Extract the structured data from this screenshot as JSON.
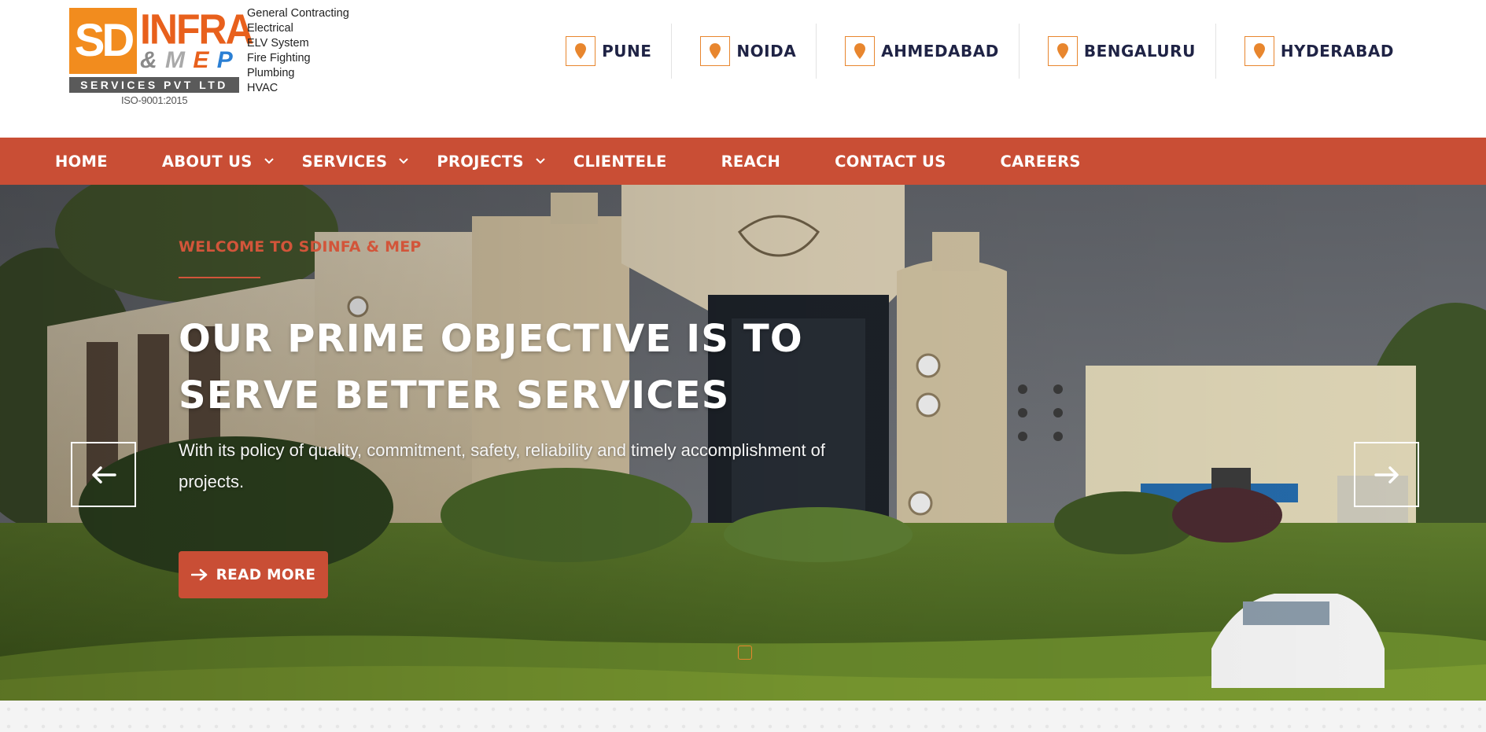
{
  "logo": {
    "mark": "SD",
    "wordmark": "INFRA",
    "mep": {
      "amp": "&",
      "m": "M",
      "e": "E",
      "p": "P"
    },
    "tagline": "SERVICES PVT LTD",
    "certification": "ISO-9001:2015",
    "services": [
      "General Contracting",
      "Electrical",
      "ELV System",
      "Fire Fighting",
      "Plumbing",
      "HVAC"
    ]
  },
  "locations": [
    {
      "label": "PUNE",
      "icon": "map-pin-icon"
    },
    {
      "label": "NOIDA",
      "icon": "map-pin-icon"
    },
    {
      "label": "AHMEDABAD",
      "icon": "map-pin-icon"
    },
    {
      "label": "BENGALURU",
      "icon": "map-pin-icon"
    },
    {
      "label": "HYDERABAD",
      "icon": "map-pin-icon"
    }
  ],
  "nav": {
    "items": [
      {
        "label": "HOME",
        "dropdown": false
      },
      {
        "label": "ABOUT US",
        "dropdown": true
      },
      {
        "label": "SERVICES",
        "dropdown": true
      },
      {
        "label": "PROJECTS",
        "dropdown": true
      },
      {
        "label": "CLIENTELE",
        "dropdown": false
      },
      {
        "label": "REACH",
        "dropdown": false
      },
      {
        "label": "CONTACT US",
        "dropdown": false
      },
      {
        "label": "CAREERS",
        "dropdown": false
      }
    ]
  },
  "hero": {
    "eyebrow": "WELCOME TO SDINFA & MEP",
    "title_line1": "OUR PRIME OBJECTIVE IS TO",
    "title_line2": "SERVE BETTER SERVICES",
    "description": "With its policy of quality, commitment, safety, reliability and timely accomplishment of projects.",
    "cta_label": "READ MORE",
    "prev_icon": "arrow-left-icon",
    "next_icon": "arrow-right-icon"
  },
  "colors": {
    "brand_red": "#c94e35",
    "brand_orange": "#e8862e",
    "text_dark": "#1f2345"
  }
}
